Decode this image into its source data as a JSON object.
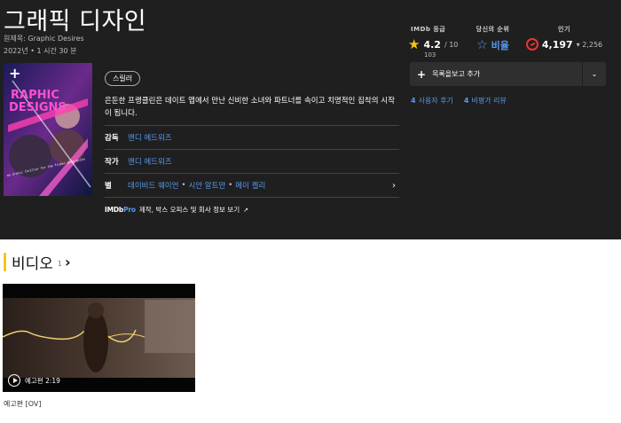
{
  "header": {
    "title": "그래픽 디자인",
    "original_title": "원제목: Graphic Desires",
    "meta": "2022년 • 1 시간 30 분"
  },
  "ratings": {
    "imdb_label": "IMDb 등급",
    "imdb_value": "4.2",
    "imdb_scale": "/ 10",
    "imdb_count": "103",
    "your_label": "당신의 순위",
    "your_value": "비율",
    "pop_label": "인기",
    "pop_value": "4,197",
    "pop_delta": "▾ 2,256"
  },
  "poster": {
    "text_line1": "RAPHIC",
    "text_line2": "DESIGNS",
    "tagline": "an erotic thriller for the Tinder generation"
  },
  "genre": "스릴러",
  "plot": "은둔한 프랭클린은 데이트 앱에서 만난 신비한 소녀와 파트너를 속이고 치명적인 집착의 시작이 됩니다.",
  "credits": {
    "director_label": "감독",
    "director": "앤디 에드워즈",
    "writer_label": "작가",
    "writer": "앤디 에드워즈",
    "stars_label": "별",
    "stars": [
      "데이비드 웨이언",
      "시안 알트만",
      "메이 켈리"
    ]
  },
  "imdbpro": {
    "logo_a": "IMDb",
    "logo_b": "Pro",
    "text": "제작, 박스 오피스 및 회사 정보 보기"
  },
  "watchlist": {
    "label": "목록을보고 추가"
  },
  "reviews": {
    "user_count": "4",
    "user_label": "사용자 후기",
    "critic_count": "4",
    "critic_label": "비평가 리뷰"
  },
  "videos": {
    "title": "비디오",
    "count": "1",
    "badge": "예고편 2:19",
    "caption": "예고편 [OV]"
  },
  "colors": {
    "accent_yellow": "#f5c518",
    "link_blue": "#5799ef",
    "hero_bg": "#1f1f1f",
    "popularity_red": "#e33333"
  }
}
